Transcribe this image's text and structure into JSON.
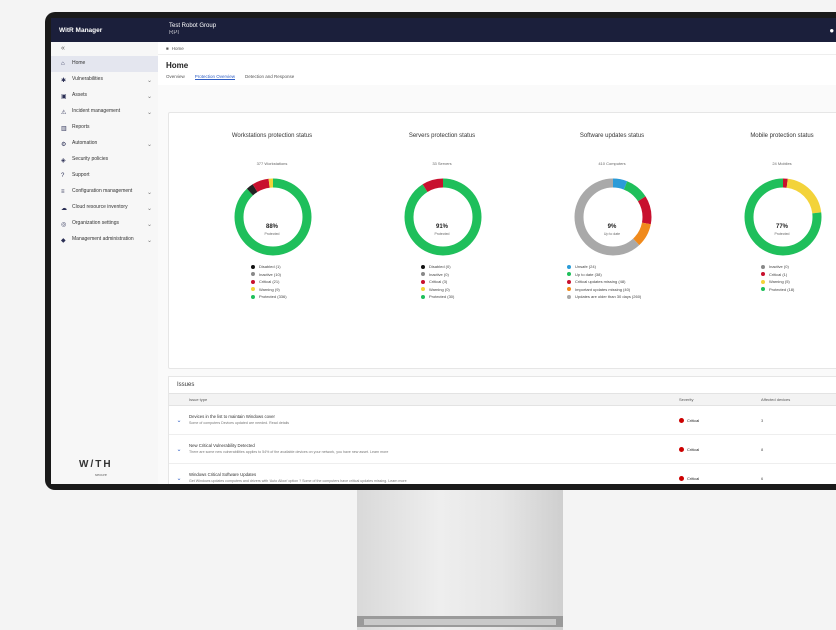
{
  "app": {
    "title": "WitR Manager",
    "tenant": "Test Robot Group",
    "tenant_sub": "RPI"
  },
  "breadcrumb": [
    "Home"
  ],
  "page": {
    "title": "Home",
    "tabs": [
      "Overview",
      "Protection Overview",
      "Detection and Response"
    ]
  },
  "sidebar": {
    "items": [
      {
        "label": "Home",
        "icon": "home-icon",
        "chevron": false,
        "active": true
      },
      {
        "label": "Vulnerabilities",
        "icon": "bug-icon",
        "chevron": true
      },
      {
        "label": "Assets",
        "icon": "device-icon",
        "chevron": true
      },
      {
        "label": "Incident management",
        "icon": "alert-icon",
        "chevron": true
      },
      {
        "label": "Reports",
        "icon": "chart-icon",
        "chevron": false
      },
      {
        "label": "Automation",
        "icon": "gear-icon",
        "chevron": true
      },
      {
        "label": "Security policies",
        "icon": "shield-icon",
        "chevron": false
      },
      {
        "label": "Support",
        "icon": "help-icon",
        "chevron": false
      },
      {
        "label": "Configuration management",
        "icon": "config-icon",
        "chevron": true
      },
      {
        "label": "Cloud resource inventory",
        "icon": "cloud-icon",
        "chevron": true
      },
      {
        "label": "Organization settings",
        "icon": "org-icon",
        "chevron": true
      },
      {
        "label": "Management administration",
        "icon": "admin-icon",
        "chevron": true
      }
    ],
    "logo": "W/TH",
    "logo_sub": "secure"
  },
  "charts": [
    {
      "title": "Workstations protection status",
      "subtitle": "377 Workstations",
      "percent": "88%",
      "center_label": "Protected",
      "segments": [
        {
          "value": 0.88,
          "color": "#1fbf5b"
        },
        {
          "value": 0.03,
          "color": "#222222"
        },
        {
          "value": 0.07,
          "color": "#c8102e"
        },
        {
          "value": 0.02,
          "color": "#f3d33a"
        }
      ],
      "legend": [
        {
          "label": "Disabled (1)",
          "color": "#111111"
        },
        {
          "label": "Inactive (10)",
          "color": "#888888"
        },
        {
          "label": "Critical (21)",
          "color": "#c8102e"
        },
        {
          "label": "Warning (9)",
          "color": "#f3d33a"
        },
        {
          "label": "Protected (336)",
          "color": "#1fbf5b"
        }
      ]
    },
    {
      "title": "Servers protection status",
      "subtitle": "33 Servers",
      "percent": "91%",
      "center_label": "Protected",
      "segments": [
        {
          "value": 0.91,
          "color": "#1fbf5b"
        },
        {
          "value": 0.09,
          "color": "#c8102e"
        }
      ],
      "legend": [
        {
          "label": "Disabled (0)",
          "color": "#111111"
        },
        {
          "label": "Inactive (0)",
          "color": "#888888"
        },
        {
          "label": "Critical (3)",
          "color": "#c8102e"
        },
        {
          "label": "Warning (0)",
          "color": "#f3d33a"
        },
        {
          "label": "Protected (30)",
          "color": "#1fbf5b"
        }
      ]
    },
    {
      "title": "Software updates status",
      "subtitle": "410 Computers",
      "percent": "9%",
      "center_label": "Up to date",
      "segments": [
        {
          "value": 0.06,
          "color": "#2a9bd8"
        },
        {
          "value": 0.1,
          "color": "#1fbf5b"
        },
        {
          "value": 0.12,
          "color": "#c8102e"
        },
        {
          "value": 0.1,
          "color": "#f08a1c"
        },
        {
          "value": 0.62,
          "color": "#a9a9a9"
        }
      ],
      "legend": [
        {
          "label": "Unsafe (24)",
          "color": "#2a9bd8"
        },
        {
          "label": "Up to date (38)",
          "color": "#1fbf5b"
        },
        {
          "label": "Critical updates missing (48)",
          "color": "#c8102e"
        },
        {
          "label": "Important updates missing (40)",
          "color": "#f08a1c"
        },
        {
          "label": "Updates are older than 30 days (260)",
          "color": "#a9a9a9"
        }
      ]
    },
    {
      "title": "Mobile protection status",
      "subtitle": "24 Mobiles",
      "percent": "77%",
      "center_label": "Protected",
      "segments": [
        {
          "value": 0.02,
          "color": "#c8102e"
        },
        {
          "value": 0.21,
          "color": "#f3d33a"
        },
        {
          "value": 0.77,
          "color": "#1fbf5b"
        }
      ],
      "legend": [
        {
          "label": "Inactive (0)",
          "color": "#888888"
        },
        {
          "label": "Critical (1)",
          "color": "#c8102e"
        },
        {
          "label": "Warning (5)",
          "color": "#f3d33a"
        },
        {
          "label": "Protected (18)",
          "color": "#1fbf5b"
        }
      ]
    }
  ],
  "issues": {
    "title": "Issues",
    "columns": [
      "Issue type",
      "Severity",
      "Affected devices"
    ],
    "rows": [
      {
        "name": "Devices in the list to maintain Windows cover",
        "desc": "Some of computers Devices updated are needed. Read details",
        "severity": "Critical",
        "count": "3"
      },
      {
        "name": "New Critical Vulnerability Detected",
        "desc": "There are some new vulnerabilities applies to 54% of the available devices on your network, you have new asset. Learn more",
        "severity": "Critical",
        "count": "8"
      },
      {
        "name": "Windows Critical Software Updates",
        "desc": "Get Windows updates computers and drivers with ‘Auto Allow’ option ? Some of the computers have critical updates missing. Learn more",
        "severity": "Critical",
        "count": "6"
      }
    ]
  },
  "colors": {
    "topbar": "#1b1f3b",
    "accent": "#2f5ec4",
    "critical": "#c8102e",
    "protected": "#1fbf5b",
    "warning": "#f3d33a"
  }
}
